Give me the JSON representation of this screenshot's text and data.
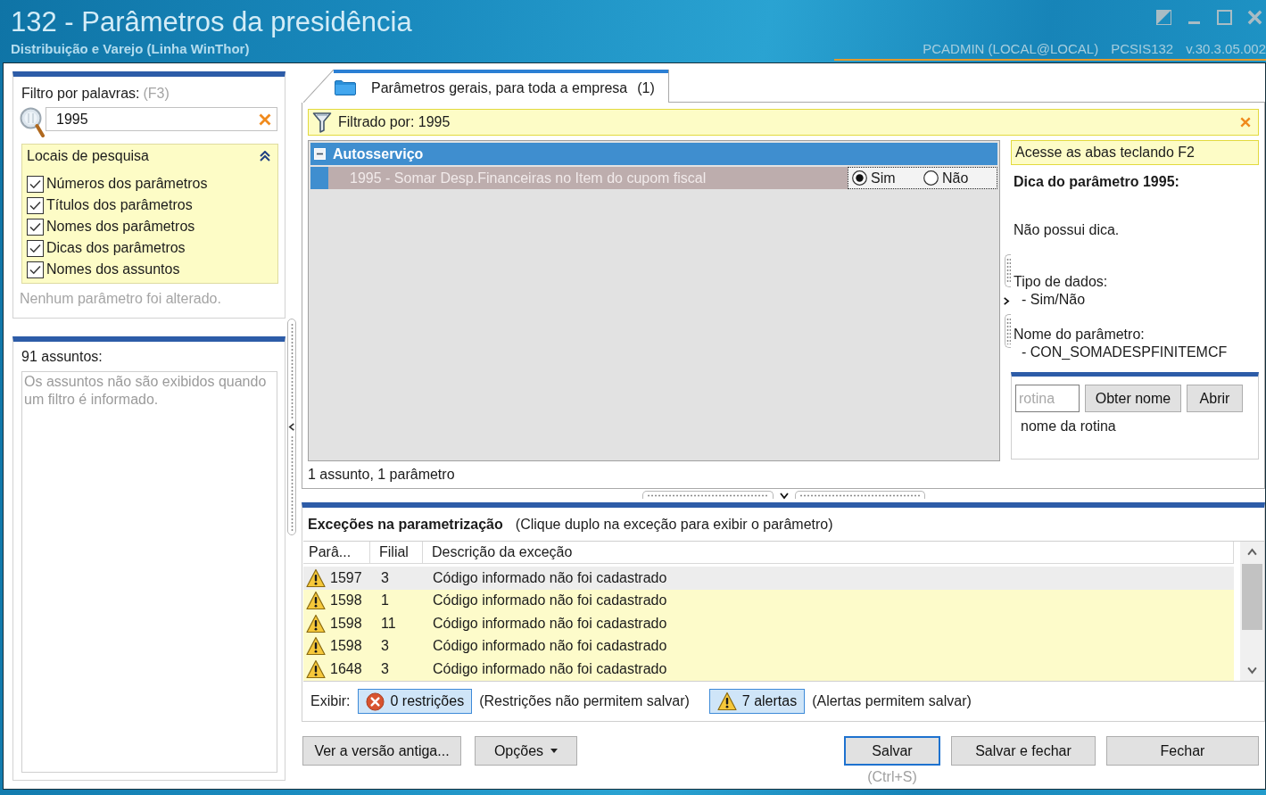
{
  "window": {
    "title": "132 - Parâmetros da presidência",
    "subtitle": "Distribuição e Varejo (Linha WinThor)",
    "user": "PCADMIN (LOCAL@LOCAL)",
    "routine": "PCSIS132",
    "version": "v.30.3.05.002"
  },
  "filter": {
    "label": "Filtro por palavras:",
    "shortcut": "(F3)",
    "value": "1995"
  },
  "search_places": {
    "title": "Locais de pesquisa",
    "expanded": true,
    "options": [
      {
        "label": "Números dos parâmetros",
        "checked": true
      },
      {
        "label": "Títulos dos parâmetros",
        "checked": true
      },
      {
        "label": "Nomes dos parâmetros",
        "checked": true
      },
      {
        "label": "Dicas dos parâmetros",
        "checked": true
      },
      {
        "label": "Nomes dos assuntos",
        "checked": true
      }
    ]
  },
  "change_status": "Nenhum parâmetro foi alterado.",
  "subjects": {
    "title": "91 assuntos:",
    "note": "Os assuntos não são exibidos quando um filtro é informado."
  },
  "tabs": [
    {
      "label": "Parâmetros gerais, para toda a empresa",
      "count": "(1)",
      "selected": true
    }
  ],
  "filter_bar": {
    "text": "Filtrado por: 1995"
  },
  "groups": [
    {
      "title": "Autosserviço",
      "expanded": true,
      "parameters": [
        {
          "label": "1995 - Somar Desp.Financeiras no Item do cupom fiscal",
          "selected": true,
          "options": [
            {
              "label": "Sim",
              "selected": true
            },
            {
              "label": "Não",
              "selected": false
            }
          ]
        }
      ]
    }
  ],
  "summary": "1 assunto, 1 parâmetro",
  "hint_panel": {
    "banner": "Acesse as abas teclando F2",
    "title": "Dica do parâmetro 1995:",
    "tip": "Não possui dica.",
    "data_type_label": "Tipo de dados:",
    "data_type": "- Sim/Não",
    "name_label": "Nome do parâmetro:",
    "name": "- CON_SOMADESPFINITEMCF"
  },
  "routine_lookup": {
    "placeholder": "rotina",
    "buttons": [
      "Obter nome",
      "Abrir"
    ],
    "result": "nome da rotina"
  },
  "exceptions": {
    "title": "Exceções na parametrização",
    "hint": "(Clique duplo na exceção para exibir o parâmetro)",
    "columns": [
      "Parâ...",
      "Filial",
      "Descrição da exceção"
    ],
    "rows": [
      {
        "kind": "alert",
        "selected": true,
        "cells": [
          "1597",
          "3",
          "Código informado não foi cadastrado"
        ]
      },
      {
        "kind": "alert",
        "selected": false,
        "cells": [
          "1598",
          "1",
          "Código informado não foi cadastrado"
        ]
      },
      {
        "kind": "alert",
        "selected": false,
        "cells": [
          "1598",
          "11",
          "Código informado não foi cadastrado"
        ]
      },
      {
        "kind": "alert",
        "selected": false,
        "cells": [
          "1598",
          "3",
          "Código informado não foi cadastrado"
        ]
      },
      {
        "kind": "alert",
        "selected": false,
        "cells": [
          "1648",
          "3",
          "Código informado não foi cadastrado"
        ]
      }
    ],
    "show_label": "Exibir:",
    "toggles": [
      {
        "kind": "restriction",
        "label": "0 restrições",
        "on": true,
        "note": "(Restrições não permitem salvar)"
      },
      {
        "kind": "alert",
        "label": "7 alertas",
        "on": true,
        "note": "(Alertas permitem salvar)"
      }
    ]
  },
  "footer_buttons": {
    "left": [
      {
        "label": "Ver a versão antiga...",
        "menu": false,
        "default": false
      },
      {
        "label": "Opções",
        "menu": true,
        "default": false
      }
    ],
    "right": [
      {
        "label": "Salvar",
        "menu": false,
        "default": true,
        "shortcut": "(Ctrl+S)"
      },
      {
        "label": "Salvar e fechar",
        "menu": false,
        "default": false
      },
      {
        "label": "Fechar",
        "menu": false,
        "default": false
      }
    ]
  }
}
